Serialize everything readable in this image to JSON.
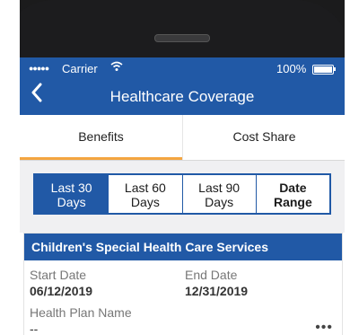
{
  "status_bar": {
    "signal": "●●●●●",
    "carrier": "Carrier",
    "battery_pct": "100%"
  },
  "nav": {
    "back_icon": "‹",
    "title": "Healthcare Coverage"
  },
  "tabs": [
    {
      "label": "Benefits",
      "active": true
    },
    {
      "label": "Cost Share",
      "active": false
    }
  ],
  "range": [
    {
      "line1": "Last 30",
      "line2": "Days",
      "active": true
    },
    {
      "line1": "Last 60",
      "line2": "Days",
      "active": false
    },
    {
      "line1": "Last 90",
      "line2": "Days",
      "active": false
    },
    {
      "line1": "Date",
      "line2": "Range",
      "active": false
    }
  ],
  "card": {
    "title": "Children's Special Health Care Services",
    "start_label": "Start Date",
    "start_value": "06/12/2019",
    "end_label": "End Date",
    "end_value": "12/31/2019",
    "plan_label": "Health Plan Name",
    "plan_value": "--",
    "more": "•••"
  },
  "colors": {
    "primary": "#2159a6",
    "tab_accent": "#f4a540"
  }
}
